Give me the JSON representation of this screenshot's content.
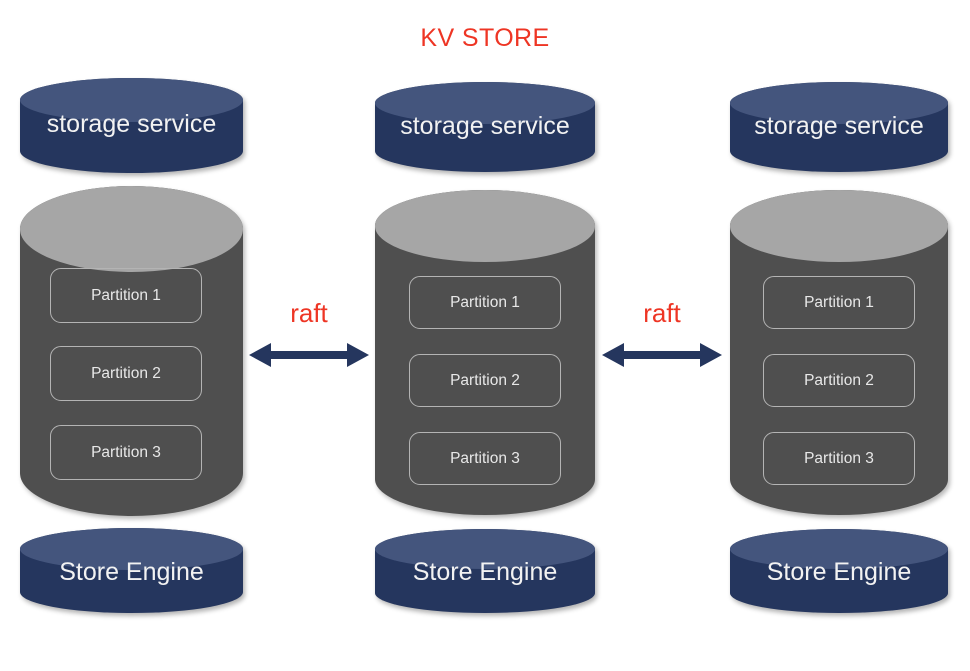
{
  "title": "KV STORE",
  "colors": {
    "accent_red": "#ee3524",
    "navy_body": "#25365e",
    "navy_top": "#44557d",
    "gray_body": "#4f4f4f",
    "gray_top": "#a6a6a6",
    "label_text": "#f2f2f2",
    "partition_border": "#b4b4b4",
    "background": "#ffffff"
  },
  "nodes": [
    {
      "id": "node-1",
      "service_label": "storage service",
      "engine_label": "Store Engine",
      "partitions": [
        {
          "label": "Partition 1"
        },
        {
          "label": "Partition 2"
        },
        {
          "label": "Partition 3"
        }
      ]
    },
    {
      "id": "node-2",
      "service_label": "storage service",
      "engine_label": "Store Engine",
      "partitions": [
        {
          "label": "Partition 1"
        },
        {
          "label": "Partition 2"
        },
        {
          "label": "Partition 3"
        }
      ]
    },
    {
      "id": "node-3",
      "service_label": "storage service",
      "engine_label": "Store Engine",
      "partitions": [
        {
          "label": "Partition 1"
        },
        {
          "label": "Partition 2"
        },
        {
          "label": "Partition 3"
        }
      ]
    }
  ],
  "connectors": [
    {
      "id": "connector-1",
      "label": "raft",
      "direction": "bidirectional"
    },
    {
      "id": "connector-2",
      "label": "raft",
      "direction": "bidirectional"
    }
  ]
}
